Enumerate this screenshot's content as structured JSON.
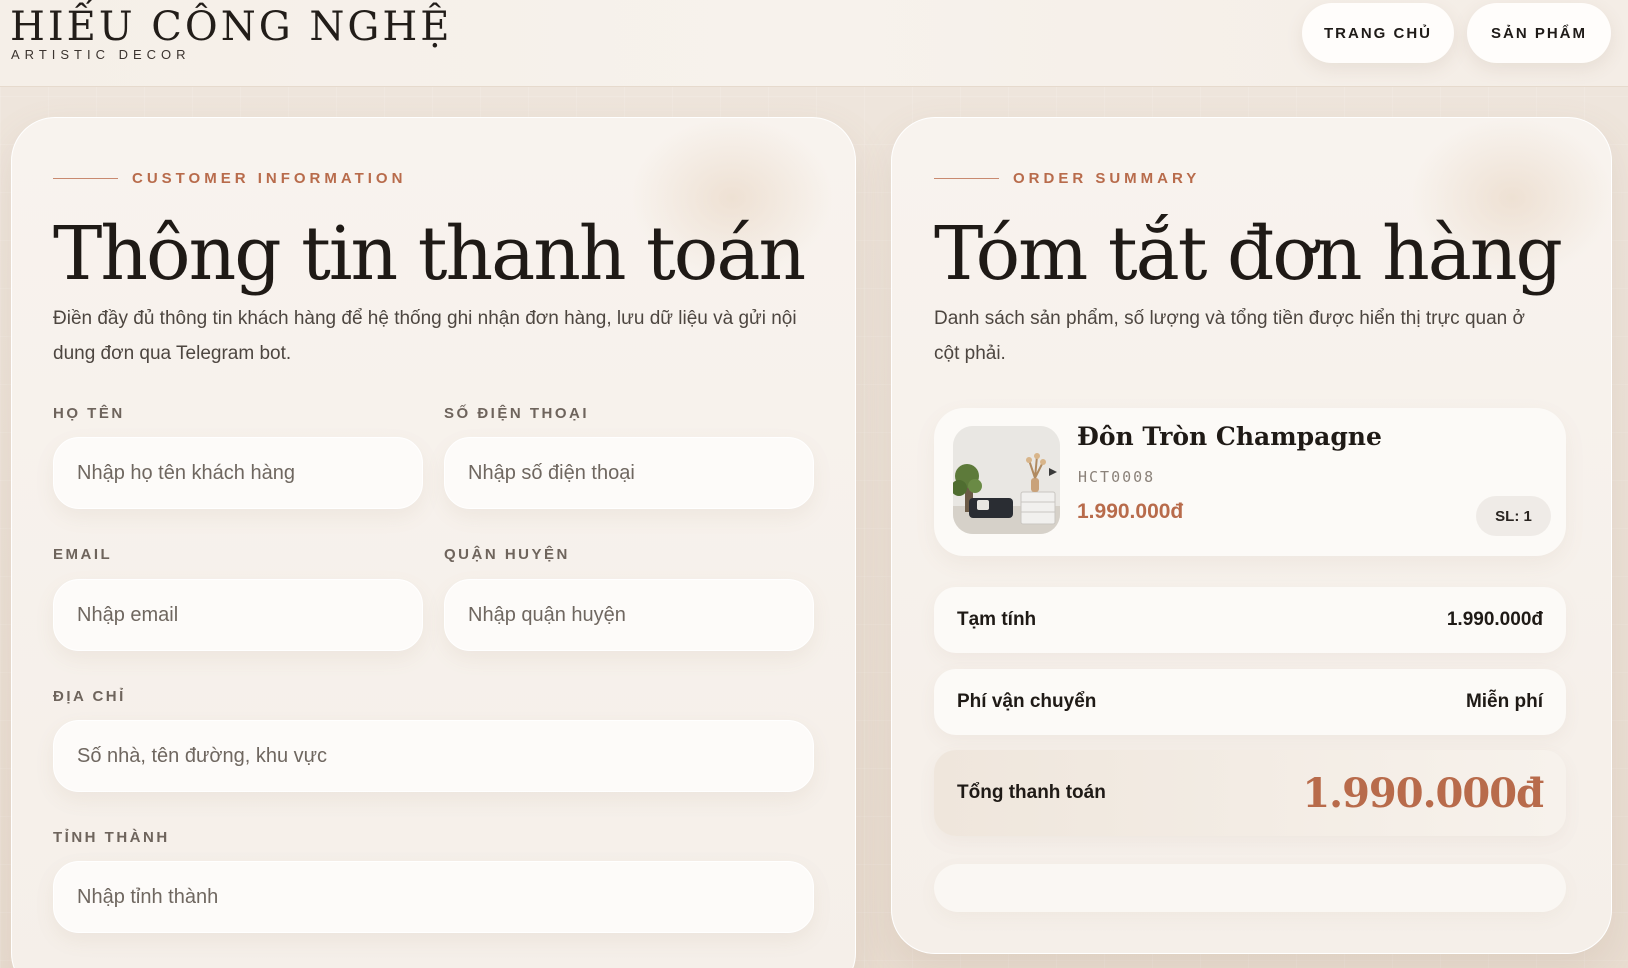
{
  "brand": {
    "title": "HIẾU CÔNG NGHỆ",
    "subtitle": "ARTISTIC DECOR"
  },
  "nav": {
    "home": "TRANG CHỦ",
    "products": "SẢN PHẨM"
  },
  "checkout": {
    "eyebrow": "CUSTOMER INFORMATION",
    "title": "Thông tin thanh toán",
    "description": "Điền đầy đủ thông tin khách hàng để hệ thống ghi nhận đơn hàng, lưu dữ liệu và gửi nội dung đơn qua Telegram bot.",
    "fields": {
      "name": {
        "label": "HỌ TÊN",
        "placeholder": "Nhập họ tên khách hàng",
        "value": ""
      },
      "phone": {
        "label": "SỐ ĐIỆN THOẠI",
        "placeholder": "Nhập số điện thoại",
        "value": ""
      },
      "email": {
        "label": "EMAIL",
        "placeholder": "Nhập email",
        "value": ""
      },
      "district": {
        "label": "QUẬN HUYỆN",
        "placeholder": "Nhập quận huyện",
        "value": ""
      },
      "address": {
        "label": "ĐỊA CHỈ",
        "placeholder": "Số nhà, tên đường, khu vực",
        "value": ""
      },
      "city": {
        "label": "TỈNH THÀNH",
        "placeholder": "Nhập tỉnh thành",
        "value": ""
      }
    }
  },
  "summary": {
    "eyebrow": "ORDER SUMMARY",
    "title": "Tóm tắt đơn hàng",
    "description": "Danh sách sản phẩm, số lượng và tổng tiền được hiển thị trực quan ở cột phải.",
    "item": {
      "name": "Đôn Tròn Champagne",
      "sku": "HCT0008",
      "price": "1.990.000đ",
      "quantity": "SL: 1",
      "thumbnail": "product-thumbnail"
    },
    "subtotal": {
      "label": "Tạm tính",
      "value": "1.990.000đ"
    },
    "shipping": {
      "label": "Phí vận chuyển",
      "value": "Miễn phí"
    },
    "total": {
      "label": "Tổng thanh toán",
      "value": "1.990.000đ"
    }
  },
  "colors": {
    "accent": "#b86b4b",
    "text": "#1f1b18",
    "background": "#ece2d8",
    "card": "#f7f2ed"
  }
}
